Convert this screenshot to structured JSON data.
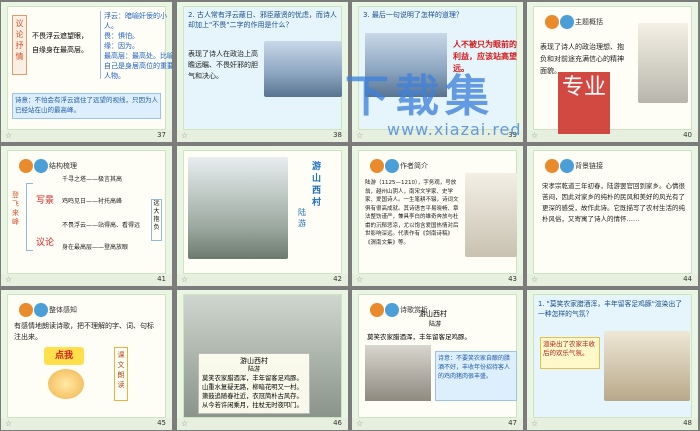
{
  "slides": [
    {
      "num": "37",
      "left_vertical": "议论抒情",
      "line1": "不畏浮云遮望眼，",
      "line2": "自缘身在最高层。",
      "notes": [
        "浮云：暗喻奸佞的小人。",
        "畏：惧怕。",
        "缘：因为。",
        "最高层：最高处。比喻自己是身居高位的重要人物。"
      ],
      "bottom": "诗意：不怕会有浮云遮住了远望的视线，只因为人已经站在山的最高峰。"
    },
    {
      "num": "38",
      "q": "2. 古人常有浮云蔽日、邪臣蔽贤的忧虑，而诗人却加上\"不畏\"二字的作用是什么？",
      "answer": "表现了诗人在政治上高瞻远瞩、不畏奸邪的胆气和决心。"
    },
    {
      "num": "39",
      "q": "3. 最后一句说明了怎样的道理？",
      "answer": "人不被只为眼前的利益，应该站高望远。"
    },
    {
      "num": "40",
      "tag": "主题概括",
      "text": "表现了诗人的政治理想、抱负和对前途充满信心的精神面貌。"
    },
    {
      "num": "41",
      "tag": "结构梳理",
      "left": "登飞来峰",
      "b1": "写景",
      "b2": "议论",
      "l1": "千寻之塔——极言其高",
      "l2": "鸡鸣见日——衬托高峰",
      "l3": "不畏浮云——站得高、看得远",
      "l4": "身在最高层——登高放眼",
      "right": "远大抱负"
    },
    {
      "num": "42",
      "title": "游山西村",
      "author": "陆游"
    },
    {
      "num": "43",
      "tag": "作者简介",
      "text": "陆游（1125—1210），字务观，号放翁，越州山阴人，南宋文学家、史学家、爱国诗人。一生笔耕不辍，诗词文俱有很高成就。其诗语言平易晓畅、章法整饬谨严，兼具李白的雄奇奔放与杜甫的沉郁悲凉，尤以饱含爱国热情对后世影响深远。代表作有《剑南诗稿》《渭南文集》等。"
    },
    {
      "num": "44",
      "tag": "背景链接",
      "text": "宋孝宗乾道三年初春，陆游罢官回到家乡。心情很苦闷，因此对家乡的纯朴的民风和美好的风光有了更深的感受，故作此诗。它既描写了农村生活的纯朴风俗，又寄寓了诗人的情怀……"
    },
    {
      "num": "45",
      "tag": "整体感知",
      "bullet": "有感情地朗读诗歌，把不理解的字、词、句标注出来。",
      "btn1": "点我",
      "btn2": "课文朗读"
    },
    {
      "num": "46",
      "poem_title": "游山西村",
      "poem_author": "陆游",
      "poem_lines": [
        "莫笑农家腊酒浑，丰年留客足鸡豚。",
        "山重水复疑无路，柳暗花明又一村。",
        "箫鼓追随春社近，衣冠简朴古风存。",
        "从今若许闲乘月，拄杖无时夜叩门。"
      ]
    },
    {
      "num": "47",
      "tag": "诗歌赏析",
      "title": "游山西村",
      "author": "陆游",
      "line": "莫笑农家腊酒浑，丰年留客足鸡豚。",
      "notes": "诗意：不要笑农家自酿的腊酒不好，丰收年份招待客人的鸡肉猪肉很丰盛。"
    },
    {
      "num": "48",
      "q": "1. \"莫笑农家腊酒浑，丰年留客足鸡豚\"渲染出了一种怎样的气氛？",
      "answer": "渲染出了农家丰收后的欢乐气氛。"
    }
  ],
  "watermark": {
    "big": "下载集",
    "seal": "专业",
    "url": "www.xiazai.red"
  }
}
